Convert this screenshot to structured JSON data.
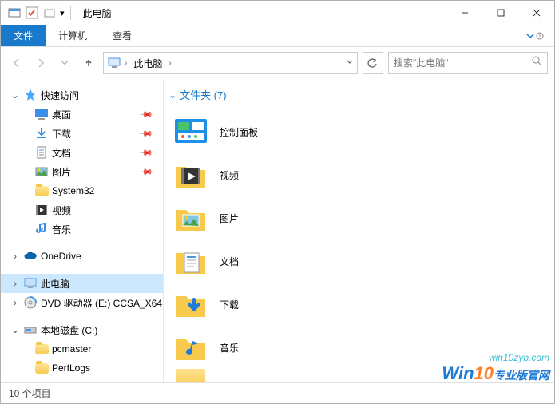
{
  "window": {
    "title": "此电脑",
    "controls": {
      "minimize": "—",
      "maximize": "☐",
      "close": "✕"
    }
  },
  "ribbon": {
    "file": "文件",
    "computer": "计算机",
    "view": "查看"
  },
  "nav": {
    "address_label": "此电脑",
    "search_placeholder": "搜索\"此电脑\""
  },
  "sidebar": {
    "quick_access": "快速访问",
    "desktop": "桌面",
    "downloads": "下载",
    "documents": "文档",
    "pictures": "图片",
    "system32": "System32",
    "videos": "视频",
    "music": "音乐",
    "onedrive": "OneDrive",
    "this_pc": "此电脑",
    "dvd": "DVD 驱动器 (E:) CCSA_X64",
    "local_disk": "本地磁盘 (C:)",
    "pcmaster": "pcmaster",
    "perflogs": "PerfLogs"
  },
  "group": {
    "folders_header": "文件夹 (7)"
  },
  "items": {
    "control_panel": "控制面板",
    "videos": "视频",
    "pictures": "图片",
    "documents": "文档",
    "downloads": "下载",
    "music": "音乐"
  },
  "status": {
    "count": "10 个项目"
  },
  "watermark": {
    "url": "win10zyb.com",
    "brand": "Win",
    "ten": "10",
    "cn": "专业版官网"
  }
}
